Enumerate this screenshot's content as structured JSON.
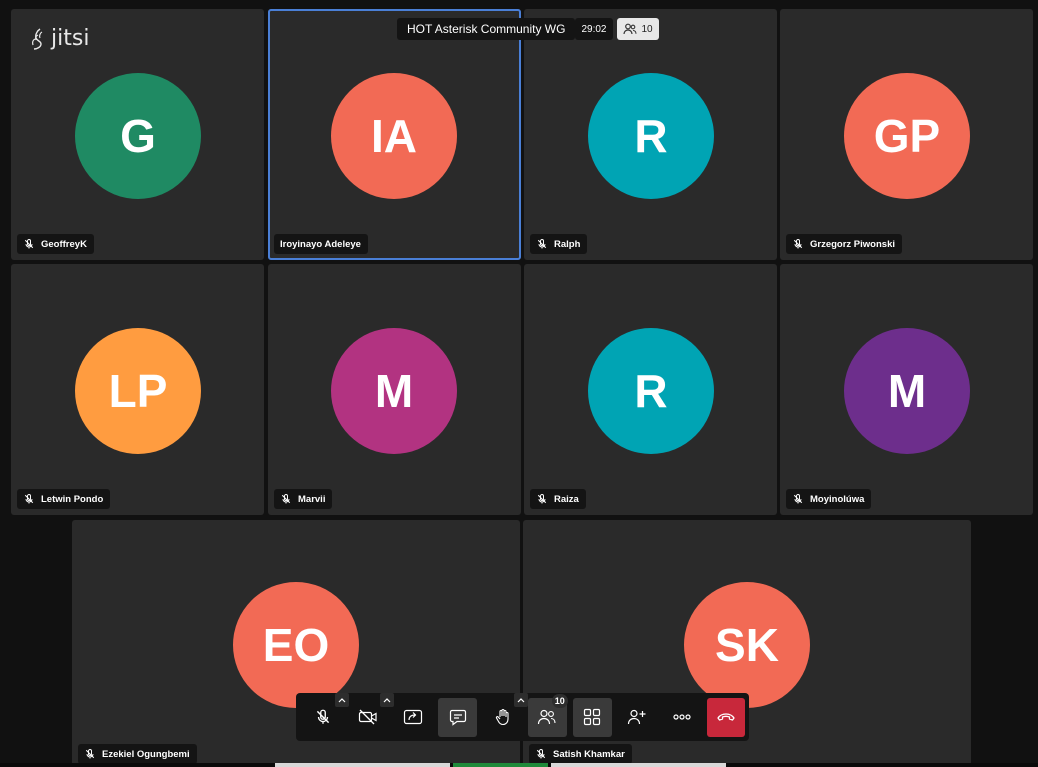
{
  "app": {
    "logo_text": "jitsi"
  },
  "header": {
    "meeting_title": "HOT Asterisk Community WG",
    "timer": "29:02",
    "participant_count": "10"
  },
  "participants": [
    {
      "initials": "G",
      "name": "GeoffreyK",
      "color": "#1f8a63",
      "muted": true
    },
    {
      "initials": "IA",
      "name": "Iroyinayo Adeleye",
      "color": "#f26a55",
      "muted": false,
      "active_speaker": true
    },
    {
      "initials": "R",
      "name": "Ralph",
      "color": "#00a4b4",
      "muted": true
    },
    {
      "initials": "GP",
      "name": "Grzegorz Piwonski",
      "color": "#f26a55",
      "muted": true
    },
    {
      "initials": "LP",
      "name": "Letwin Pondo",
      "color": "#ff9c40",
      "muted": true
    },
    {
      "initials": "M",
      "name": "Marvii",
      "color": "#b23381",
      "muted": true
    },
    {
      "initials": "R",
      "name": "Raiza",
      "color": "#00a4b4",
      "muted": true
    },
    {
      "initials": "M",
      "name": "Moyinolúwa",
      "color": "#6d2e8c",
      "muted": true
    },
    {
      "initials": "EO",
      "name": "Ezekiel Ogungbemi",
      "color": "#f26a55",
      "muted": true
    },
    {
      "initials": "SK",
      "name": "Satish Khamkar",
      "color": "#f26a55",
      "muted": true
    }
  ],
  "toolbar": {
    "buttons": [
      {
        "id": "microphone",
        "icon": "microphone-off-icon"
      },
      {
        "id": "camera",
        "icon": "camera-off-icon"
      },
      {
        "id": "share-screen",
        "icon": "share-screen-icon"
      },
      {
        "id": "chat",
        "icon": "chat-icon"
      },
      {
        "id": "raise-hand",
        "icon": "raise-hand-icon"
      },
      {
        "id": "participants",
        "icon": "participants-icon",
        "badge": "10"
      },
      {
        "id": "tile-view",
        "icon": "tile-view-icon"
      },
      {
        "id": "invite",
        "icon": "invite-icon"
      },
      {
        "id": "more",
        "icon": "more-options-icon"
      },
      {
        "id": "hangup",
        "icon": "hangup-icon"
      }
    ]
  },
  "colors": {
    "tile_bg": "#2a2a2a",
    "active_outline": "#4a7fd6",
    "hangup": "#c8283b"
  }
}
